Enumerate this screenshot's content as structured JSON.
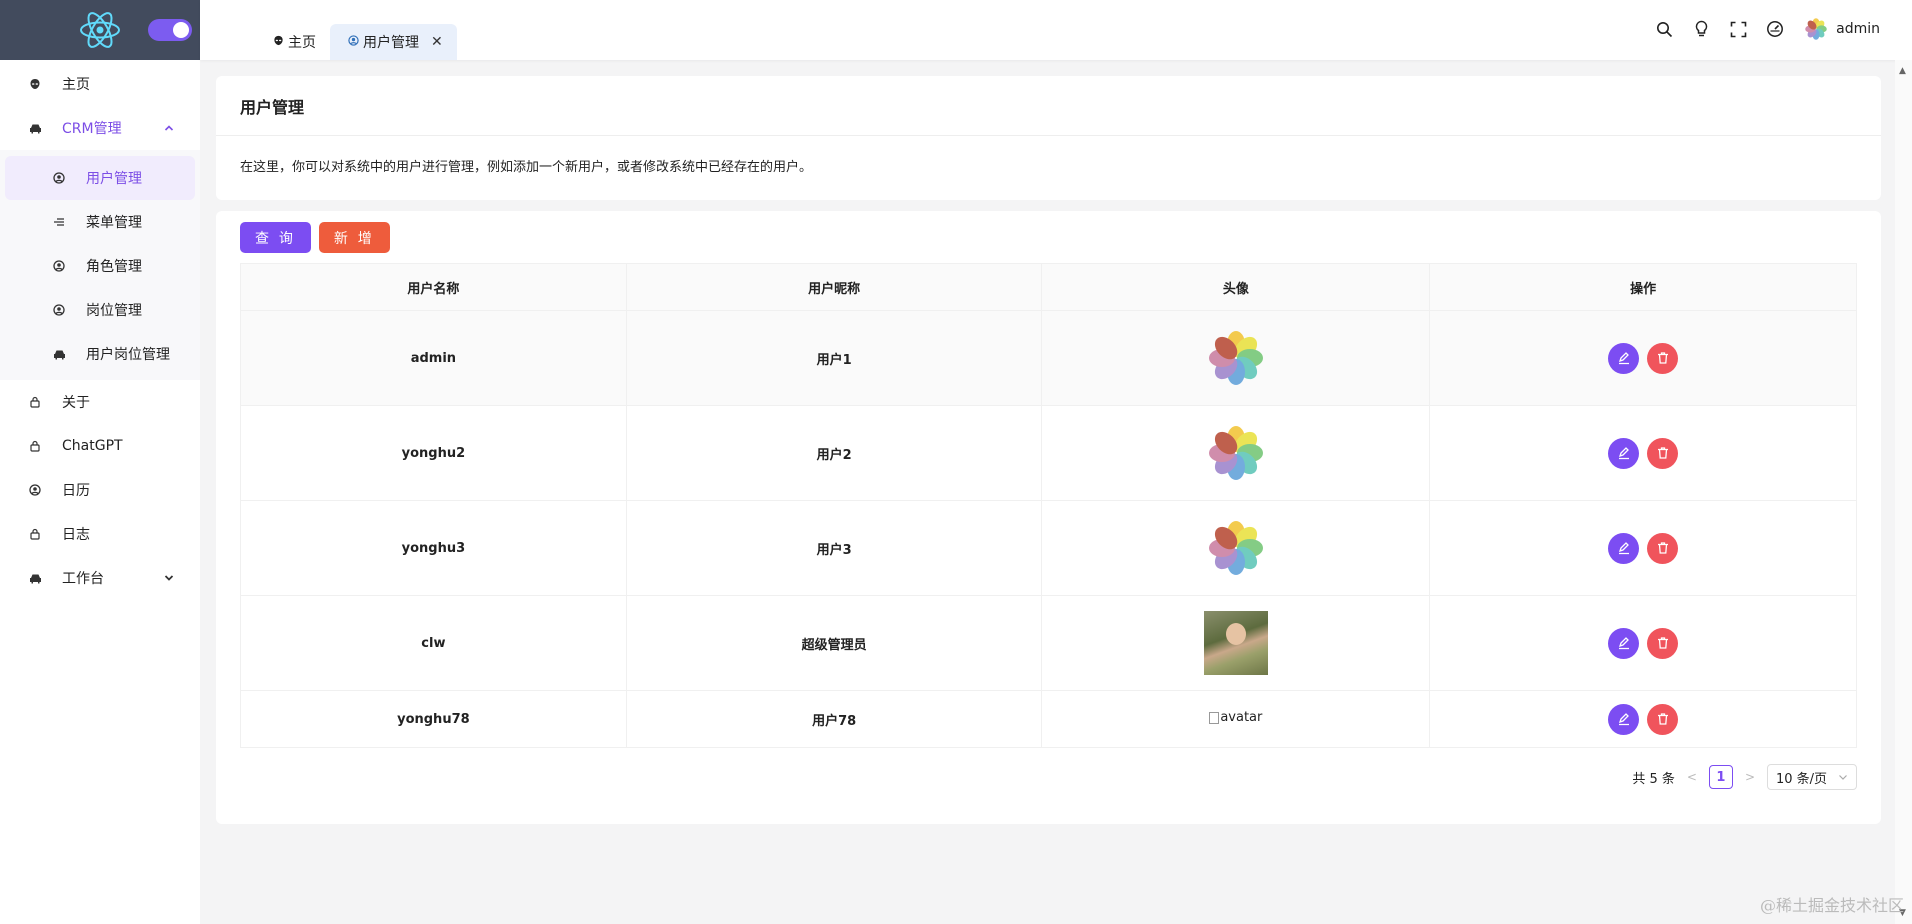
{
  "colors": {
    "accent": "#7c4df2",
    "danger": "#f0545c",
    "add": "#ee5c3c",
    "sidebar_brand_bg": "#424b5d"
  },
  "sidebar": {
    "items": [
      {
        "label": "主页",
        "icon": "alien-icon"
      },
      {
        "label": "CRM管理",
        "icon": "car-icon",
        "expanded": true,
        "children": [
          {
            "label": "用户管理",
            "icon": "user-circle-icon",
            "active": true
          },
          {
            "label": "菜单管理",
            "icon": "menu-lines-icon"
          },
          {
            "label": "角色管理",
            "icon": "user-circle-icon"
          },
          {
            "label": "岗位管理",
            "icon": "user-circle-icon"
          },
          {
            "label": "用户岗位管理",
            "icon": "car-icon"
          }
        ]
      },
      {
        "label": "关于",
        "icon": "lock-icon"
      },
      {
        "label": "ChatGPT",
        "icon": "lock-icon"
      },
      {
        "label": "日历",
        "icon": "user-circle-icon"
      },
      {
        "label": "日志",
        "icon": "lock-icon"
      },
      {
        "label": "工作台",
        "icon": "car-icon",
        "expanded": false
      }
    ]
  },
  "tabs": [
    {
      "label": "主页"
    },
    {
      "label": "用户管理",
      "closable": true
    }
  ],
  "header": {
    "username": "admin"
  },
  "intro": {
    "title": "用户管理",
    "description": "在这里，你可以对系统中的用户进行管理，例如添加一个新用户，或者修改系统中已经存在的用户。"
  },
  "toolbar": {
    "query_label": "查 询",
    "add_label": "新 增"
  },
  "table": {
    "headers": [
      "用户名称",
      "用户昵称",
      "头像",
      "操作"
    ],
    "rows": [
      {
        "username": "admin",
        "nickname": "用户1",
        "avatar": "flower"
      },
      {
        "username": "yonghu2",
        "nickname": "用户2",
        "avatar": "flower"
      },
      {
        "username": "yonghu3",
        "nickname": "用户3",
        "avatar": "flower"
      },
      {
        "username": "clw",
        "nickname": "超级管理员",
        "avatar": "photo"
      },
      {
        "username": "yonghu78",
        "nickname": "用户78",
        "avatar": "broken",
        "avatar_alt": "avatar"
      }
    ]
  },
  "pagination": {
    "total_text": "共 5 条",
    "current_page": "1",
    "page_size": "10 条/页"
  },
  "watermark": "@稀土掘金技术社区"
}
